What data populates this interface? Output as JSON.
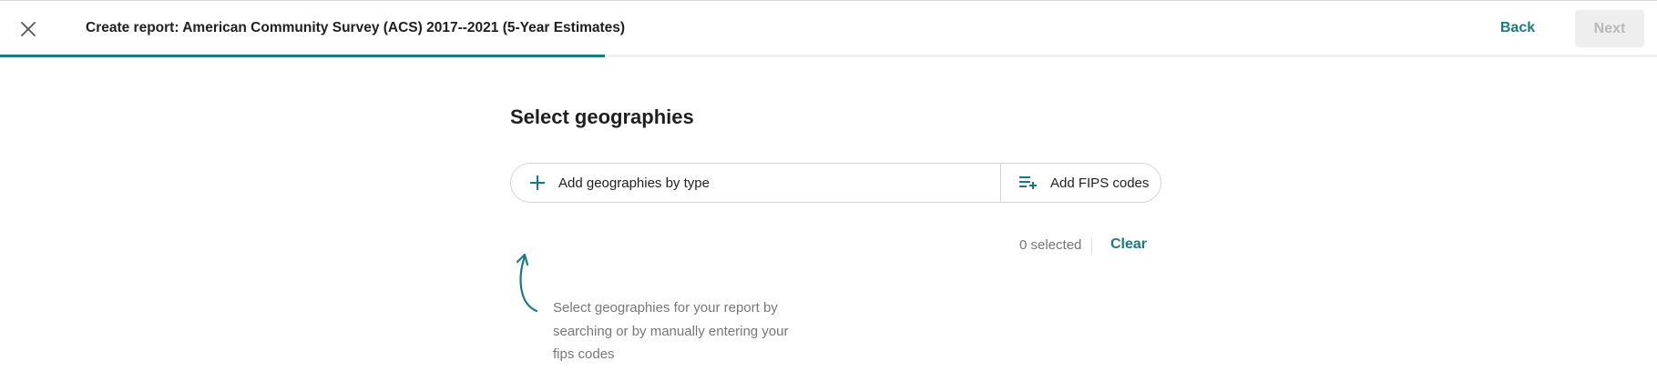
{
  "header": {
    "close_icon": "close-icon",
    "title": "Create report: American Community Survey (ACS) 2017--2021 (5-Year Estimates)",
    "back_label": "Back",
    "next_label": "Next",
    "progress_fraction": 0.365,
    "accent_color": "#1a7a82"
  },
  "main": {
    "title": "Select geographies",
    "add_by_type": {
      "icon": "plus-icon",
      "label": "Add geographies by type"
    },
    "add_fips": {
      "icon": "playlist-add-icon",
      "label": "Add FIPS codes"
    },
    "selected_count": "0 selected",
    "clear_label": "Clear",
    "hint_icon": "curved-arrow-icon",
    "hint_text": "Select geographies for your report by searching or by manually entering your fips codes"
  }
}
